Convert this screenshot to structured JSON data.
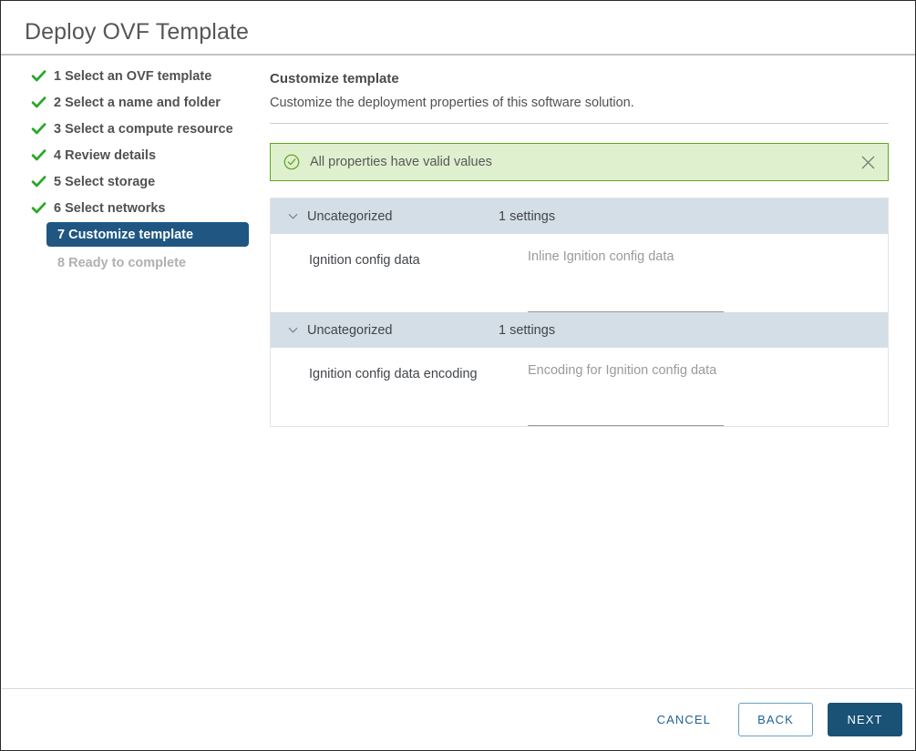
{
  "window": {
    "title": "Deploy OVF Template"
  },
  "nav": {
    "items": [
      {
        "label": "1 Select an OVF template",
        "state": "done",
        "icon": "check-icon"
      },
      {
        "label": "2 Select a name and folder",
        "state": "done",
        "icon": "check-icon"
      },
      {
        "label": "3 Select a compute resource",
        "state": "done",
        "icon": "check-icon"
      },
      {
        "label": "4 Review details",
        "state": "done",
        "icon": "check-icon"
      },
      {
        "label": "5 Select storage",
        "state": "done",
        "icon": "check-icon"
      },
      {
        "label": "6 Select networks",
        "state": "done",
        "icon": "check-icon"
      },
      {
        "label": "7 Customize template",
        "state": "current",
        "icon": ""
      },
      {
        "label": "8 Ready to complete",
        "state": "pending",
        "icon": ""
      }
    ]
  },
  "main": {
    "title": "Customize template",
    "subtitle": "Customize the deployment properties of this software solution."
  },
  "alert": {
    "icon": "success-check-circle-icon",
    "message": "All properties have valid values",
    "close_icon": "close-icon",
    "background_color": "#dff0cf",
    "border_color": "#62a420",
    "icon_color": "#62a420"
  },
  "groups": [
    {
      "name": "Uncategorized",
      "count_label": "1 settings",
      "chevron_icon": "chevron-down-icon",
      "settings": [
        {
          "label": "Ignition config data",
          "description": "Inline Ignition config data",
          "value": "",
          "placeholder": ""
        }
      ]
    },
    {
      "name": "Uncategorized",
      "count_label": "1 settings",
      "chevron_icon": "chevron-down-icon",
      "settings": [
        {
          "label": "Ignition config data encoding",
          "description": "Encoding for Ignition config data",
          "value": "",
          "placeholder": ""
        }
      ]
    }
  ],
  "footer": {
    "cancel_label": "CANCEL",
    "back_label": "BACK",
    "next_label": "NEXT",
    "accent_color": "#1a5276",
    "link_color": "#1f6493"
  }
}
